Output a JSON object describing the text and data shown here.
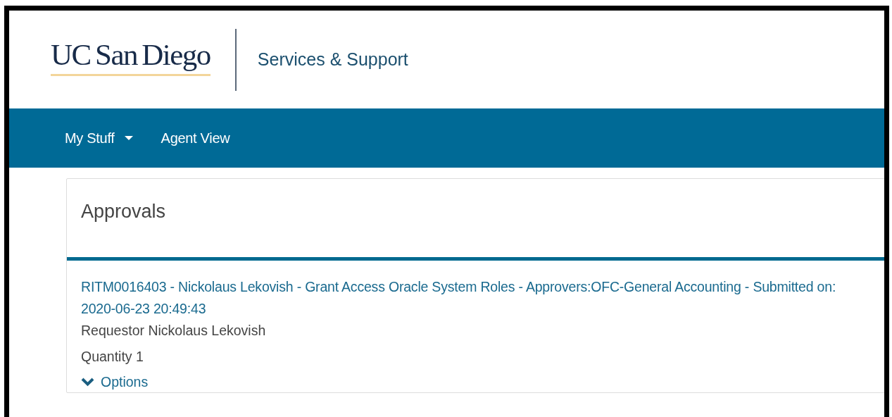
{
  "header": {
    "logo": "UC San Diego",
    "title": "Services & Support"
  },
  "nav": [
    {
      "label": "My Stuff",
      "kind": "dropdown"
    },
    {
      "label": "Agent View",
      "kind": "link"
    }
  ],
  "card": {
    "title": "Approvals",
    "items": [
      {
        "link": "RITM0016403 - Nickolaus Lekovish - Grant Access Oracle System Roles - Approvers:OFC-General Accounting - Submitted on: 2020-06-23 20:49:43",
        "requestor": "Requestor Nickolaus Lekovish",
        "quantity": "Quantity 1",
        "options": {
          "label": "Options",
          "expanded": false
        }
      }
    ]
  }
}
